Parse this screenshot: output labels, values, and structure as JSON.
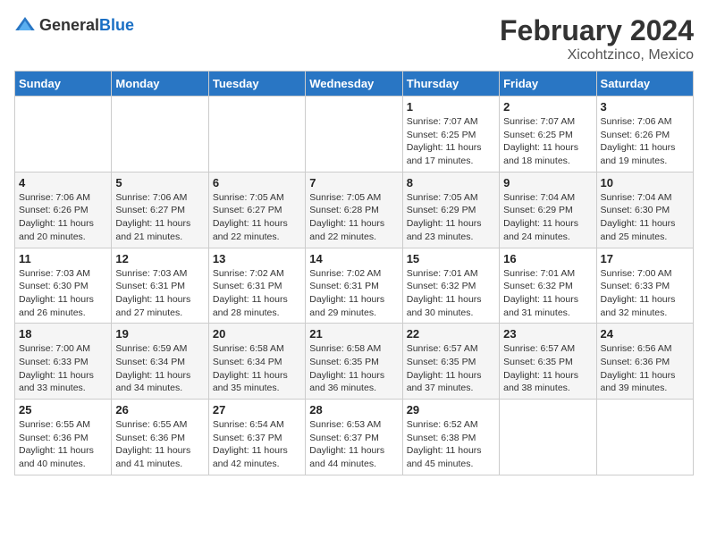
{
  "header": {
    "logo_general": "General",
    "logo_blue": "Blue",
    "month_year": "February 2024",
    "location": "Xicohtzinco, Mexico"
  },
  "days_of_week": [
    "Sunday",
    "Monday",
    "Tuesday",
    "Wednesday",
    "Thursday",
    "Friday",
    "Saturday"
  ],
  "weeks": [
    [
      {
        "day": "",
        "info": ""
      },
      {
        "day": "",
        "info": ""
      },
      {
        "day": "",
        "info": ""
      },
      {
        "day": "",
        "info": ""
      },
      {
        "day": "1",
        "info": "Sunrise: 7:07 AM\nSunset: 6:25 PM\nDaylight: 11 hours\nand 17 minutes."
      },
      {
        "day": "2",
        "info": "Sunrise: 7:07 AM\nSunset: 6:25 PM\nDaylight: 11 hours\nand 18 minutes."
      },
      {
        "day": "3",
        "info": "Sunrise: 7:06 AM\nSunset: 6:26 PM\nDaylight: 11 hours\nand 19 minutes."
      }
    ],
    [
      {
        "day": "4",
        "info": "Sunrise: 7:06 AM\nSunset: 6:26 PM\nDaylight: 11 hours\nand 20 minutes."
      },
      {
        "day": "5",
        "info": "Sunrise: 7:06 AM\nSunset: 6:27 PM\nDaylight: 11 hours\nand 21 minutes."
      },
      {
        "day": "6",
        "info": "Sunrise: 7:05 AM\nSunset: 6:27 PM\nDaylight: 11 hours\nand 22 minutes."
      },
      {
        "day": "7",
        "info": "Sunrise: 7:05 AM\nSunset: 6:28 PM\nDaylight: 11 hours\nand 22 minutes."
      },
      {
        "day": "8",
        "info": "Sunrise: 7:05 AM\nSunset: 6:29 PM\nDaylight: 11 hours\nand 23 minutes."
      },
      {
        "day": "9",
        "info": "Sunrise: 7:04 AM\nSunset: 6:29 PM\nDaylight: 11 hours\nand 24 minutes."
      },
      {
        "day": "10",
        "info": "Sunrise: 7:04 AM\nSunset: 6:30 PM\nDaylight: 11 hours\nand 25 minutes."
      }
    ],
    [
      {
        "day": "11",
        "info": "Sunrise: 7:03 AM\nSunset: 6:30 PM\nDaylight: 11 hours\nand 26 minutes."
      },
      {
        "day": "12",
        "info": "Sunrise: 7:03 AM\nSunset: 6:31 PM\nDaylight: 11 hours\nand 27 minutes."
      },
      {
        "day": "13",
        "info": "Sunrise: 7:02 AM\nSunset: 6:31 PM\nDaylight: 11 hours\nand 28 minutes."
      },
      {
        "day": "14",
        "info": "Sunrise: 7:02 AM\nSunset: 6:31 PM\nDaylight: 11 hours\nand 29 minutes."
      },
      {
        "day": "15",
        "info": "Sunrise: 7:01 AM\nSunset: 6:32 PM\nDaylight: 11 hours\nand 30 minutes."
      },
      {
        "day": "16",
        "info": "Sunrise: 7:01 AM\nSunset: 6:32 PM\nDaylight: 11 hours\nand 31 minutes."
      },
      {
        "day": "17",
        "info": "Sunrise: 7:00 AM\nSunset: 6:33 PM\nDaylight: 11 hours\nand 32 minutes."
      }
    ],
    [
      {
        "day": "18",
        "info": "Sunrise: 7:00 AM\nSunset: 6:33 PM\nDaylight: 11 hours\nand 33 minutes."
      },
      {
        "day": "19",
        "info": "Sunrise: 6:59 AM\nSunset: 6:34 PM\nDaylight: 11 hours\nand 34 minutes."
      },
      {
        "day": "20",
        "info": "Sunrise: 6:58 AM\nSunset: 6:34 PM\nDaylight: 11 hours\nand 35 minutes."
      },
      {
        "day": "21",
        "info": "Sunrise: 6:58 AM\nSunset: 6:35 PM\nDaylight: 11 hours\nand 36 minutes."
      },
      {
        "day": "22",
        "info": "Sunrise: 6:57 AM\nSunset: 6:35 PM\nDaylight: 11 hours\nand 37 minutes."
      },
      {
        "day": "23",
        "info": "Sunrise: 6:57 AM\nSunset: 6:35 PM\nDaylight: 11 hours\nand 38 minutes."
      },
      {
        "day": "24",
        "info": "Sunrise: 6:56 AM\nSunset: 6:36 PM\nDaylight: 11 hours\nand 39 minutes."
      }
    ],
    [
      {
        "day": "25",
        "info": "Sunrise: 6:55 AM\nSunset: 6:36 PM\nDaylight: 11 hours\nand 40 minutes."
      },
      {
        "day": "26",
        "info": "Sunrise: 6:55 AM\nSunset: 6:36 PM\nDaylight: 11 hours\nand 41 minutes."
      },
      {
        "day": "27",
        "info": "Sunrise: 6:54 AM\nSunset: 6:37 PM\nDaylight: 11 hours\nand 42 minutes."
      },
      {
        "day": "28",
        "info": "Sunrise: 6:53 AM\nSunset: 6:37 PM\nDaylight: 11 hours\nand 44 minutes."
      },
      {
        "day": "29",
        "info": "Sunrise: 6:52 AM\nSunset: 6:38 PM\nDaylight: 11 hours\nand 45 minutes."
      },
      {
        "day": "",
        "info": ""
      },
      {
        "day": "",
        "info": ""
      }
    ]
  ]
}
